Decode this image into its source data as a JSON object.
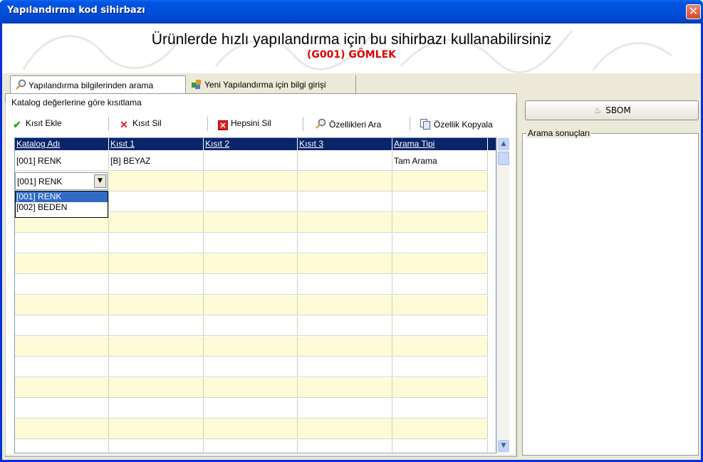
{
  "window": {
    "title": "Yapılandırma kod sihirbazı",
    "close_glyph": "✕"
  },
  "header": {
    "title": "Ürünlerde hızlı yapılandırma için bu sihirbazı kullanabilirsiniz",
    "subtitle": "(G001) GÖMLEK"
  },
  "tabs": [
    {
      "label": "Yapılandırma bilgilerinden arama",
      "icon": "magnifier-icon",
      "active": true
    },
    {
      "label": "Yeni Yapılandırma için bilgi girişi",
      "icon": "puzzle-icon",
      "active": false
    }
  ],
  "groupbox": {
    "label": "Katalog değerlerine göre kısıtlama"
  },
  "toolbar": {
    "add": "Kısıt Ekle",
    "delete": "Kısıt Sil",
    "delete_all": "Hepsini Sil",
    "search_props": "Özellikleri Ara",
    "copy_prop": "Özellik Kopyala"
  },
  "grid": {
    "columns": [
      "Katalog Adı",
      "Kısıt 1",
      "Kısıt 2",
      "Kısıt 3",
      "Arama Tipi"
    ],
    "rows": [
      [
        "[001] RENK",
        "[B] BEYAZ",
        "",
        "",
        "Tam Arama"
      ]
    ]
  },
  "combo": {
    "value": "[001] RENK",
    "options": [
      "[001] RENK",
      "[002] BEDEN"
    ],
    "selected_index": 0
  },
  "right": {
    "sbom_label": "SBOM",
    "results_label": "Arama sonuçları"
  },
  "colors": {
    "title_bar": "#0054e3",
    "selection": "#316ac5",
    "header_row": "#0a246a",
    "subtitle": "#e00000",
    "alt_row": "#fffbd6"
  }
}
